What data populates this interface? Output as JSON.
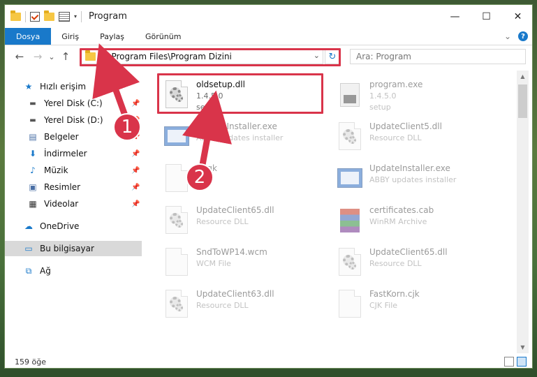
{
  "window": {
    "title": "Program",
    "minimize_icon": "—",
    "maximize_icon": "☐",
    "close_icon": "✕"
  },
  "ribbon": {
    "tabs": [
      "Dosya",
      "Giriş",
      "Paylaş",
      "Görünüm"
    ],
    "expand_icon": "⌄",
    "help_label": "?"
  },
  "nav": {
    "back": "←",
    "forward": "→",
    "recent": "⌄",
    "up": "↑",
    "address": "C:\\Program Files\\Program Dizini",
    "refresh": "↻",
    "search_placeholder": "Ara: Program"
  },
  "sidebar": {
    "items": [
      {
        "label": "Hızlı erişim",
        "icon": "star-icon"
      },
      {
        "label": "Yerel Disk (C:)",
        "icon": "drive-icon",
        "pinned": true
      },
      {
        "label": "Yerel Disk (D:)",
        "icon": "drive-icon",
        "pinned": true
      },
      {
        "label": "Belgeler",
        "icon": "documents-icon",
        "pinned": true
      },
      {
        "label": "İndirmeler",
        "icon": "downloads-icon",
        "pinned": true
      },
      {
        "label": "Müzik",
        "icon": "music-icon",
        "pinned": true
      },
      {
        "label": "Resimler",
        "icon": "pictures-icon",
        "pinned": true
      },
      {
        "label": "Videolar",
        "icon": "videos-icon",
        "pinned": true
      },
      {
        "label": "OneDrive",
        "icon": "cloud-icon"
      },
      {
        "label": "Bu bilgisayar",
        "icon": "computer-icon",
        "selected": true
      },
      {
        "label": "Ağ",
        "icon": "network-icon"
      }
    ]
  },
  "files": [
    {
      "name": "oldsetup.dll",
      "line2": "1.4.5.0",
      "line3": "setup",
      "icon": "dll-icon",
      "highlight": true
    },
    {
      "name": "program.exe",
      "line2": "1.4.5.0",
      "line3": "setup",
      "icon": "exe-icon"
    },
    {
      "name": "UpdateInstaller.exe",
      "line2": "ABBY updates installer",
      "icon": "installer-icon"
    },
    {
      "name": "UpdateClient5.dll",
      "line2": "Resource DLL",
      "icon": "dll-icon"
    },
    {
      "name": "Ucgk",
      "line2": "Kilit",
      "icon": "file-icon"
    },
    {
      "name": "UpdateInstaller.exe",
      "line2": "ABBY updates installer",
      "icon": "installer-icon"
    },
    {
      "name": "UpdateClient65.dll",
      "line2": "Resource DLL",
      "icon": "dll-icon"
    },
    {
      "name": "certificates.cab",
      "line2": "WinRM Archive",
      "icon": "archive-icon"
    },
    {
      "name": "SndToWP14.wcm",
      "line2": "WCM File",
      "icon": "file-icon"
    },
    {
      "name": "UpdateClient65.dll",
      "line2": "Resource DLL",
      "icon": "dll-icon"
    },
    {
      "name": "UpdateClient63.dll",
      "line2": "Resource DLL",
      "icon": "dll-icon"
    },
    {
      "name": "FastKorn.cjk",
      "line2": "CJK File",
      "icon": "file-icon"
    }
  ],
  "status": {
    "count": "159 öğe"
  },
  "callouts": {
    "one": "1",
    "two": "2"
  },
  "colors": {
    "accent": "#1979ca",
    "highlight": "#d9344a"
  }
}
